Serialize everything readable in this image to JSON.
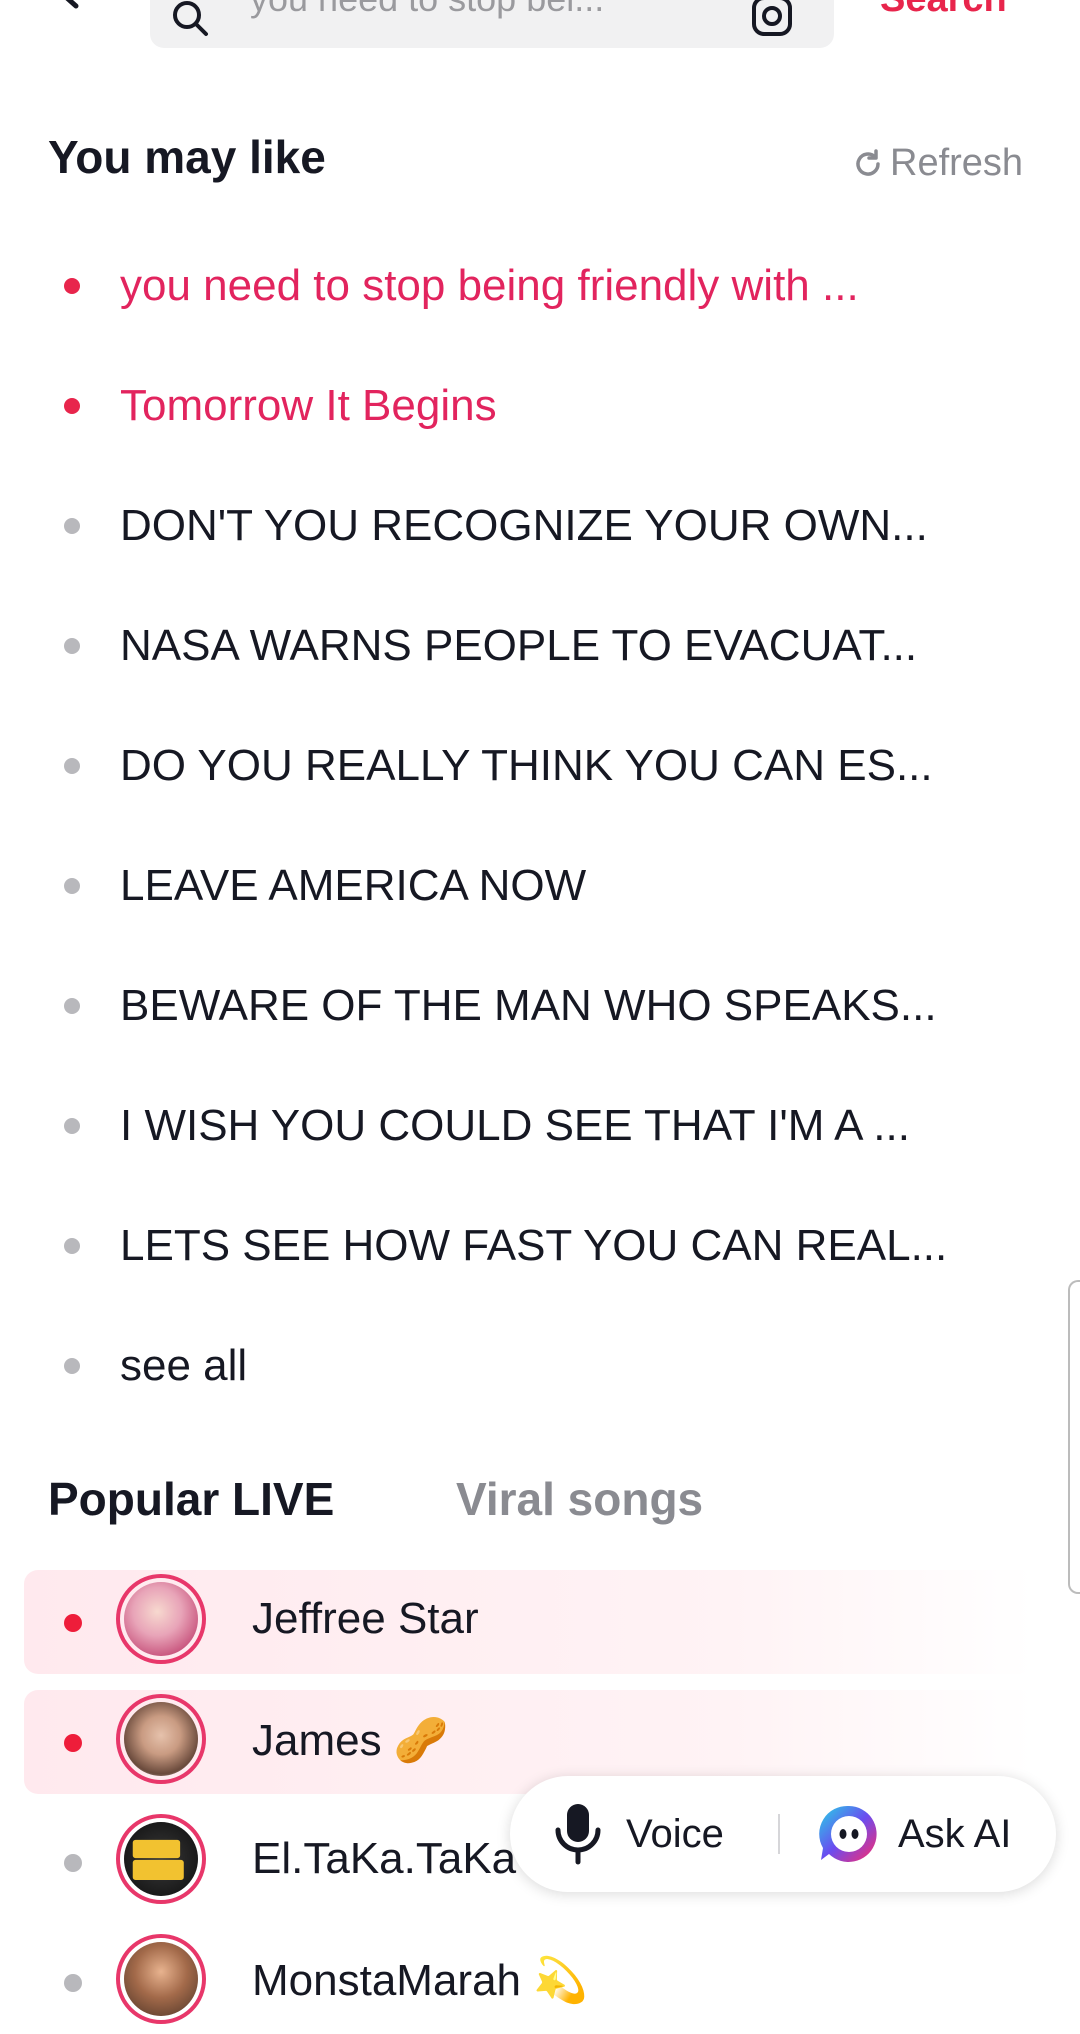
{
  "header": {
    "search_text": "you need to stop bei...",
    "search_button": "Search"
  },
  "you_may_like": {
    "title": "You may like",
    "refresh_label": "Refresh",
    "items": [
      {
        "label": "you need to stop being friendly with ...",
        "hot": true
      },
      {
        "label": "Tomorrow It Begins",
        "hot": true
      },
      {
        "label": "DON'T YOU RECOGNIZE YOUR OWN...",
        "hot": false
      },
      {
        "label": "NASA WARNS PEOPLE TO EVACUAT...",
        "hot": false
      },
      {
        "label": "DO YOU REALLY THINK YOU CAN ES...",
        "hot": false
      },
      {
        "label": "LEAVE AMERICA NOW",
        "hot": false
      },
      {
        "label": "BEWARE OF THE MAN WHO SPEAKS...",
        "hot": false
      },
      {
        "label": "I WISH YOU COULD SEE THAT I'M A ...",
        "hot": false
      },
      {
        "label": "LETS SEE HOW FAST YOU CAN REAL...",
        "hot": false
      },
      {
        "label": "see all",
        "hot": false
      }
    ]
  },
  "tabs": {
    "active": "Popular LIVE",
    "inactive": "Viral songs"
  },
  "live": [
    {
      "name": "Jeffree Star",
      "emoji": "",
      "highlighted": true
    },
    {
      "name": "James",
      "emoji": "🥜",
      "highlighted": true
    },
    {
      "name": "El.TaKa.TaKa",
      "emoji": "",
      "highlighted": false
    },
    {
      "name": "MonstaMarah",
      "emoji": "💫",
      "highlighted": false
    }
  ],
  "float_bar": {
    "voice_label": "Voice",
    "ai_label": "Ask AI"
  },
  "colors": {
    "accent": "#e8254c",
    "hot_text": "#e2245e",
    "muted": "#8a8b91"
  }
}
